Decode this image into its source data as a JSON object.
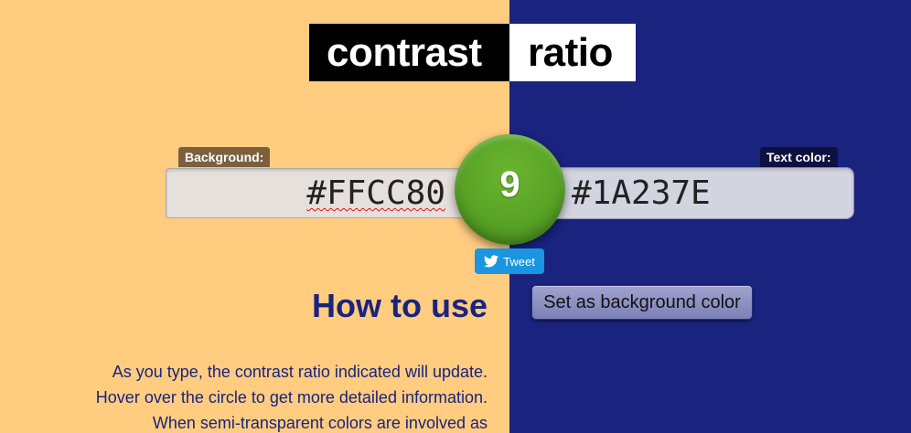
{
  "title": {
    "word1": "contrast",
    "word2": "ratio"
  },
  "background": {
    "label": "Background:",
    "value": "#FFCC80"
  },
  "text_color": {
    "label": "Text color:",
    "value": "#1A237E"
  },
  "result": {
    "ratio": "9"
  },
  "tweet": {
    "label": "Tweet"
  },
  "how_to": {
    "heading": "How to use",
    "lines": [
      "As you type, the contrast ratio indicated will update.",
      "Hover over the circle to get more detailed information.",
      "When semi-transparent colors are involved as"
    ]
  },
  "set_bg_button": {
    "label": "Set as background color"
  },
  "colors": {
    "left_bg": "#FFCC80",
    "right_bg": "#1A237E",
    "ratio_circle": "#58A325",
    "tweet_button": "#1B95E0"
  },
  "icons": {
    "tweet": "twitter-bird-icon"
  }
}
